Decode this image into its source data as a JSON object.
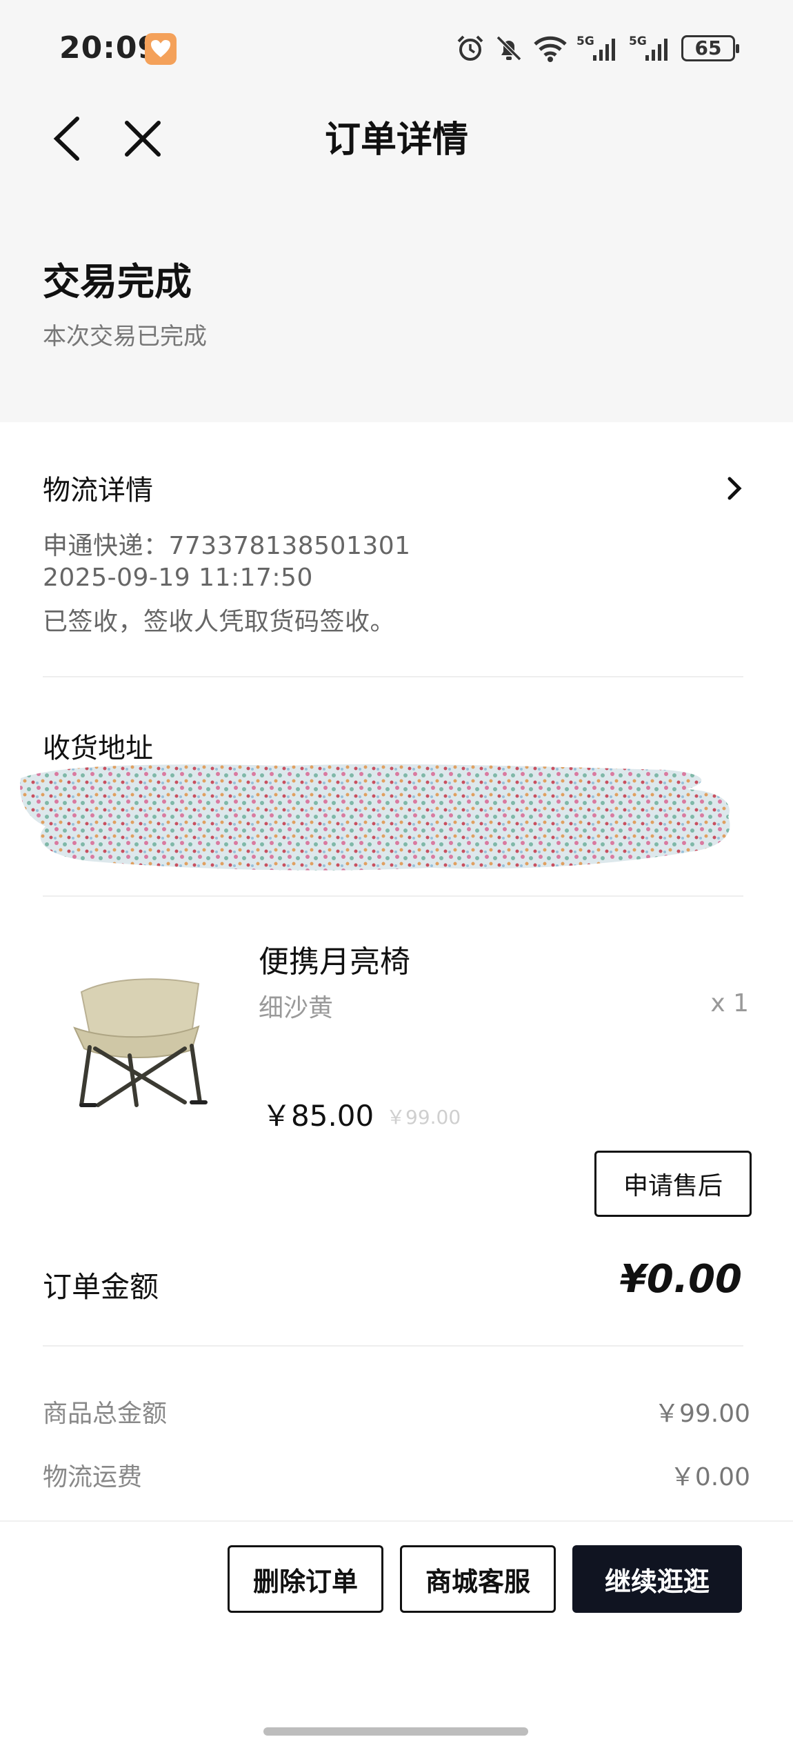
{
  "status_bar": {
    "time": "20:09",
    "battery": "65",
    "icons": [
      "heart-app-icon",
      "alarm-icon",
      "bell-muted-icon",
      "wifi-icon",
      "5g-signal-icon",
      "5g-signal-icon",
      "battery-icon"
    ]
  },
  "nav": {
    "title": "订单详情",
    "back_icon": "chevron-left-icon",
    "close_icon": "close-icon"
  },
  "order_status": {
    "title": "交易完成",
    "subtitle": "本次交易已完成"
  },
  "logistics": {
    "title": "物流详情",
    "tracking": "申通快递：773378138501301",
    "time": "2025-09-19 11:17:50",
    "message": "已签收，签收人凭取货码签收。"
  },
  "address": {
    "title": "收货地址"
  },
  "product": {
    "name": "便携月亮椅",
    "spec": "细沙黄",
    "qty": "x 1",
    "price": "￥85.00",
    "original_price": "￥99.00",
    "after_sale_label": "申请售后"
  },
  "order_amount": {
    "label": "订单金额",
    "value": "¥0.00",
    "rows": [
      {
        "label": "商品总金额",
        "value": "￥99.00"
      },
      {
        "label": "物流运费",
        "value": "￥0.00"
      }
    ]
  },
  "actions": {
    "delete_label": "删除订单",
    "service_label": "商城客服",
    "continue_label": "继续逛逛"
  },
  "colors": {
    "page_bg": "#ffffff",
    "header_bg": "#f6f6f6",
    "primary_dark": "#101421",
    "muted_text": "#777777"
  }
}
